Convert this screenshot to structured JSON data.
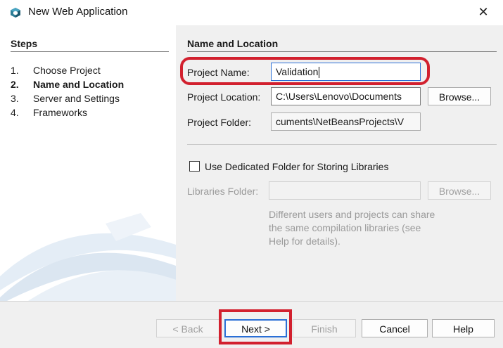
{
  "window": {
    "title": "New Web Application",
    "close_glyph": "✕"
  },
  "steps": {
    "heading": "Steps",
    "items": [
      {
        "num": "1.",
        "label": "Choose Project",
        "active": false
      },
      {
        "num": "2.",
        "label": "Name and Location",
        "active": true
      },
      {
        "num": "3.",
        "label": "Server and Settings",
        "active": false
      },
      {
        "num": "4.",
        "label": "Frameworks",
        "active": false
      }
    ]
  },
  "form": {
    "heading": "Name and Location",
    "project_name_label": "Project Name:",
    "project_name_value": "Validation",
    "project_location_label": "Project Location:",
    "project_location_value": "C:\\Users\\Lenovo\\Documents",
    "browse_label": "Browse...",
    "project_folder_label": "Project Folder:",
    "project_folder_value": "cuments\\NetBeansProjects\\V",
    "dedicated_folder_checkbox_label": "Use Dedicated Folder for Storing Libraries",
    "dedicated_folder_checked": false,
    "libraries_folder_label": "Libraries Folder:",
    "libraries_folder_value": "",
    "libraries_browse_label": "Browse...",
    "hint_text": "Different users and projects can share the same compilation libraries (see Help for details)."
  },
  "footer": {
    "back_label": "< Back",
    "next_label": "Next >",
    "finish_label": "Finish",
    "cancel_label": "Cancel",
    "help_label": "Help"
  },
  "colors": {
    "accent": "#2a6fd6",
    "highlight": "#d2202e",
    "icon": "#2e7d96"
  },
  "icons": {
    "app": "netbeans-cube-icon",
    "close": "close-icon"
  }
}
